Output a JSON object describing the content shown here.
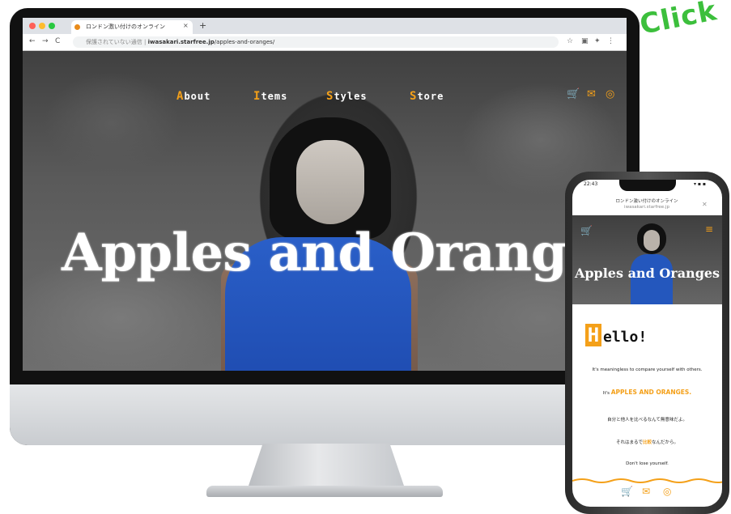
{
  "badge": {
    "text": "Click",
    "color": "#3cbf3c"
  },
  "browser": {
    "tab_title": "ロンドン激い付けのオンライン",
    "tab_close": "×",
    "new_tab": "+",
    "nav": {
      "back": "←",
      "forward": "→",
      "reload": "C"
    },
    "address_prefix": "保護されていない通信",
    "address_domain": "iwasakari.starfree.jp",
    "address_path": "/apples-and-oranges/"
  },
  "site": {
    "accent": "#f4a019",
    "nav_items": [
      {
        "initial": "A",
        "rest": "bout"
      },
      {
        "initial": "I",
        "rest": "tems"
      },
      {
        "initial": "S",
        "rest": "tyles"
      },
      {
        "initial": "S",
        "rest": "tore"
      }
    ],
    "icons": {
      "cart": "🛒",
      "mail": "✉",
      "instagram": "◎"
    },
    "hero_title": "Apples and Oranges"
  },
  "phone": {
    "time": "22:43",
    "signal": "▾ ▪ ▪",
    "page_title": "ロンドン激い付けのオンライン",
    "page_url": "iwasakari.starfree.jp",
    "hero_title": "Apples and Oranges",
    "hello_initial": "H",
    "hello_rest": "ello!",
    "lines": [
      "It's meaningless to compare yourself with others.",
      "It's ",
      "APPLES AND ORANGES.",
      "自分と他人を比べるなんて無意味だよ。",
      "それはまるで",
      "比較",
      "なんだから。",
      "Don't lose yourself."
    ],
    "bottom_icons": {
      "cart": "🛒",
      "mail": "✉",
      "instagram": "◎"
    }
  }
}
